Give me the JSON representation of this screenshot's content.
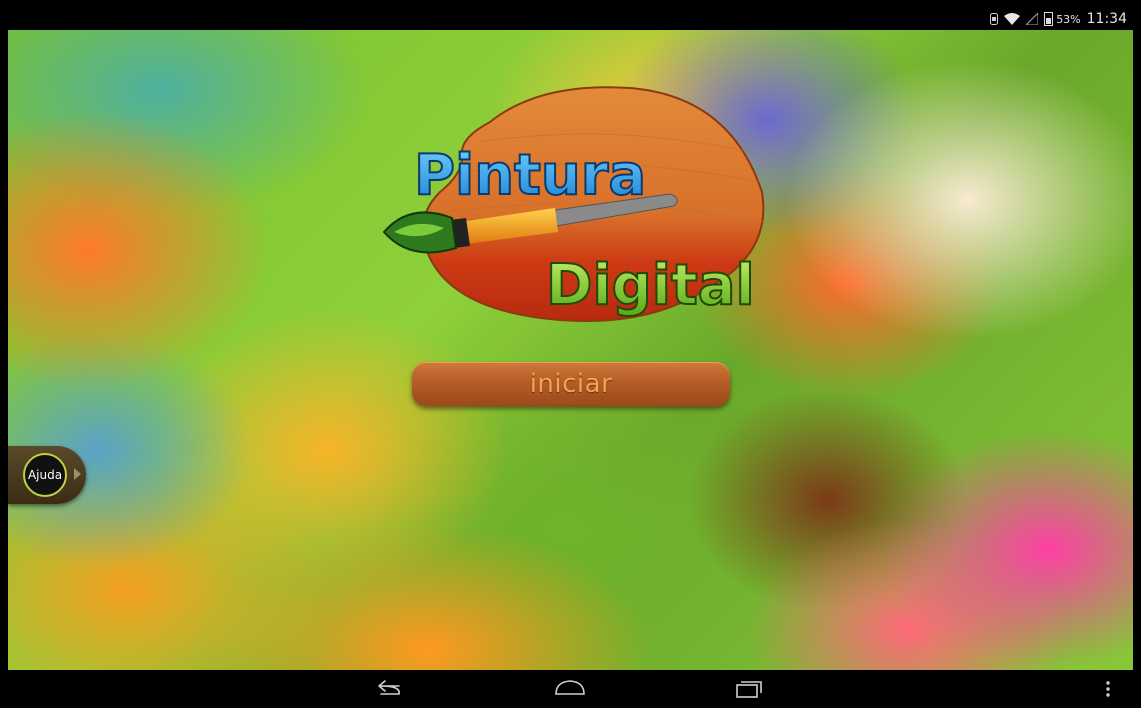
{
  "status_bar": {
    "battery_percent": "53%",
    "time": "11:34",
    "icons": [
      "sim-icon",
      "wifi-icon",
      "signal-icon",
      "battery-icon"
    ]
  },
  "logo": {
    "word1": "Pintura",
    "word2": "Digital"
  },
  "start_button": {
    "label": "iniciar"
  },
  "help": {
    "label": "Ajuda"
  },
  "nav_bar": {
    "icons": [
      "back-icon",
      "home-icon",
      "recent-apps-icon",
      "overflow-menu-icon"
    ]
  },
  "colors": {
    "button_brown": "#b45d27",
    "button_text": "#f4a24e",
    "logo_blue": "#2a9fe0",
    "logo_green": "#7ac81e",
    "palette_wood": "#d9762c",
    "help_ring": "#c2d040"
  }
}
